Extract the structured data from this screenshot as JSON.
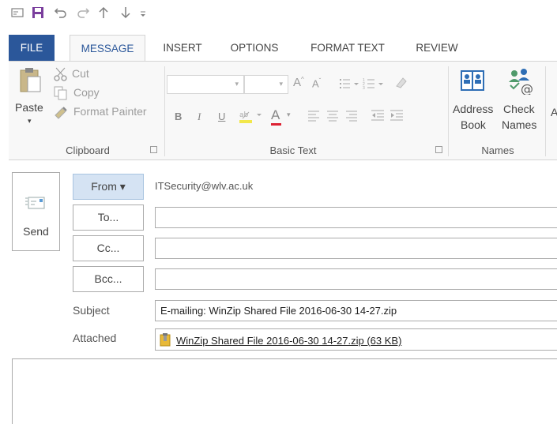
{
  "quick_access": {
    "icons": [
      "mail-icon",
      "save-icon",
      "undo-icon",
      "redo-icon",
      "up-arrow-icon",
      "down-arrow-icon",
      "customize-icon"
    ]
  },
  "tabs": [
    {
      "label": "FILE"
    },
    {
      "label": "MESSAGE"
    },
    {
      "label": "INSERT"
    },
    {
      "label": "OPTIONS"
    },
    {
      "label": "FORMAT TEXT"
    },
    {
      "label": "REVIEW"
    }
  ],
  "ribbon": {
    "clipboard": {
      "paste": "Paste",
      "cut": "Cut",
      "copy": "Copy",
      "format_painter": "Format Painter",
      "group": "Clipboard"
    },
    "basic_text": {
      "bold": "B",
      "italic": "I",
      "underline": "U",
      "font_color": "A",
      "group": "Basic Text"
    },
    "names": {
      "address_book_line1": "Address",
      "address_book_line2": "Book",
      "check_names_line1": "Check",
      "check_names_line2": "Names",
      "group": "Names"
    },
    "overflow": "A"
  },
  "compose": {
    "send": "Send",
    "from_button": "From ▾",
    "from_value": "ITSecurity@wlv.ac.uk",
    "to_button": "To...",
    "cc_button": "Cc...",
    "bcc_button": "Bcc...",
    "subject_label": "Subject",
    "subject_value": "E-mailing: WinZip Shared File 2016-06-30 14-27.zip",
    "attached_label": "Attached",
    "attachment": "WinZip Shared File 2016-06-30 14-27.zip (63 KB)"
  },
  "colors": {
    "file_tab": "#2b579a",
    "active_tab_text": "#2b579a",
    "from_button_bg": "#d5e3f3"
  }
}
